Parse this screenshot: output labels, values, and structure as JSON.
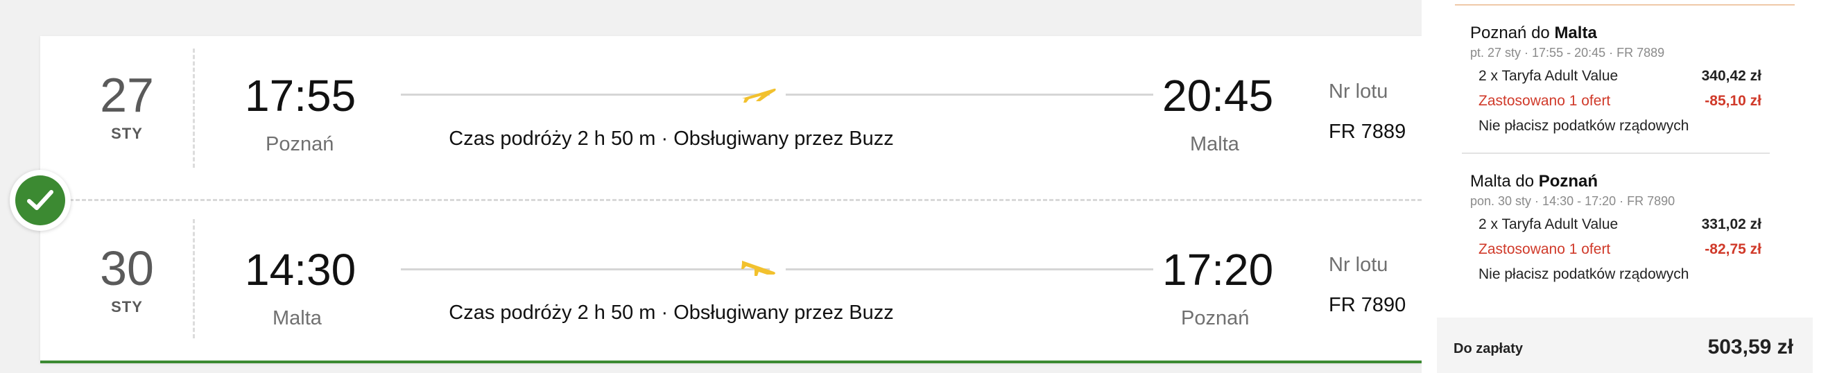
{
  "flights": [
    {
      "day": "27",
      "month": "STY",
      "departure_time": "17:55",
      "departure_city": "Poznań",
      "arrival_time": "20:45",
      "arrival_city": "Malta",
      "duration_text": "Czas podróży 2 h 50 m · Obsługiwany przez Buzz",
      "flight_no_label": "Nr lotu",
      "flight_no": "FR 7889",
      "plane_icon": "plane-takeoff-icon"
    },
    {
      "day": "30",
      "month": "STY",
      "departure_time": "14:30",
      "departure_city": "Malta",
      "arrival_time": "17:20",
      "arrival_city": "Poznań",
      "duration_text": "Czas podróży 2 h 50 m · Obsługiwany przez Buzz",
      "flight_no_label": "Nr lotu",
      "flight_no": "FR 7890",
      "plane_icon": "plane-landing-icon"
    }
  ],
  "summary": {
    "segments": [
      {
        "title_prefix": "Poznań do ",
        "title_dest": "Malta",
        "meta": "pt. 27 sty  ·  17:55 - 20:45  ·  FR 7889",
        "fare_label": "2 x Taryfa Adult Value",
        "fare_amount": "340,42 zł",
        "discount_label": "Zastosowano 1 ofert",
        "discount_amount": "-85,10 zł",
        "tax_note": "Nie płacisz podatków rządowych"
      },
      {
        "title_prefix": "Malta do ",
        "title_dest": "Poznań",
        "meta": "pon. 30 sty  ·  14:30 - 17:20  ·  FR 7890",
        "fare_label": "2 x Taryfa Adult Value",
        "fare_amount": "331,02 zł",
        "discount_label": "Zastosowano 1 ofert",
        "discount_amount": "-82,75 zł",
        "tax_note": "Nie płacisz podatków rządowych"
      }
    ],
    "total_label": "Do zapłaty",
    "total_value": "503,59 zł"
  },
  "colors": {
    "accent_green": "#3c8a32",
    "plane_yellow": "#f2c12e",
    "discount_red": "#d03a2a"
  },
  "icons": {
    "selected": "check-icon"
  }
}
